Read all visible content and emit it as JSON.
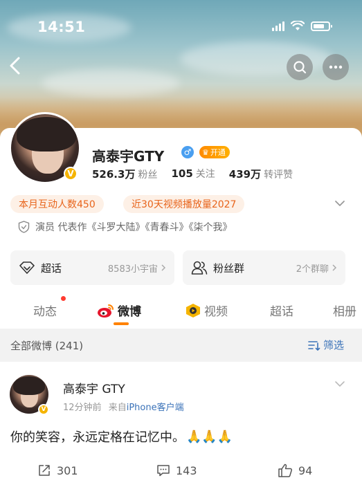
{
  "status_bar": {
    "time": "14:51"
  },
  "profile": {
    "name": "高泰宇GTY",
    "vip_badge": "开通",
    "stats": [
      {
        "value": "526.3万",
        "label": "粉丝"
      },
      {
        "value": "105",
        "label": "关注"
      },
      {
        "value": "439万",
        "label": "转评赞"
      }
    ],
    "chips": [
      "本月互动人数450",
      "近30天视频播放量2027"
    ],
    "description": "演员 代表作《斗罗大陆》《青春斗》《柒个我》"
  },
  "features": [
    {
      "label": "超话",
      "sub": "8583小宇宙",
      "icon": "diamond-icon"
    },
    {
      "label": "粉丝群",
      "sub": "2个群聊",
      "icon": "group-icon"
    }
  ],
  "tabs": [
    {
      "label": "动态"
    },
    {
      "label": "微博",
      "icon": "weibo-icon",
      "active": true
    },
    {
      "label": "视频",
      "icon": "video-icon"
    },
    {
      "label": "超话"
    },
    {
      "label": "相册"
    }
  ],
  "filter_bar": {
    "count_label": "全部微博 (241)",
    "filter_label": "筛选"
  },
  "post": {
    "author": "高泰宇 GTY",
    "time": "12分钟前",
    "source_prefix": "来自",
    "source": "iPhone客户端",
    "text": "你的笑容，永远定格在记忆中。",
    "emoji": "🙏🙏🙏",
    "repost_count": "301",
    "comment_count": "143",
    "like_count": "94"
  },
  "colors": {
    "accent_orange": "#ff8200",
    "link_blue": "#3a72b8",
    "chip_text": "#e8641b"
  }
}
